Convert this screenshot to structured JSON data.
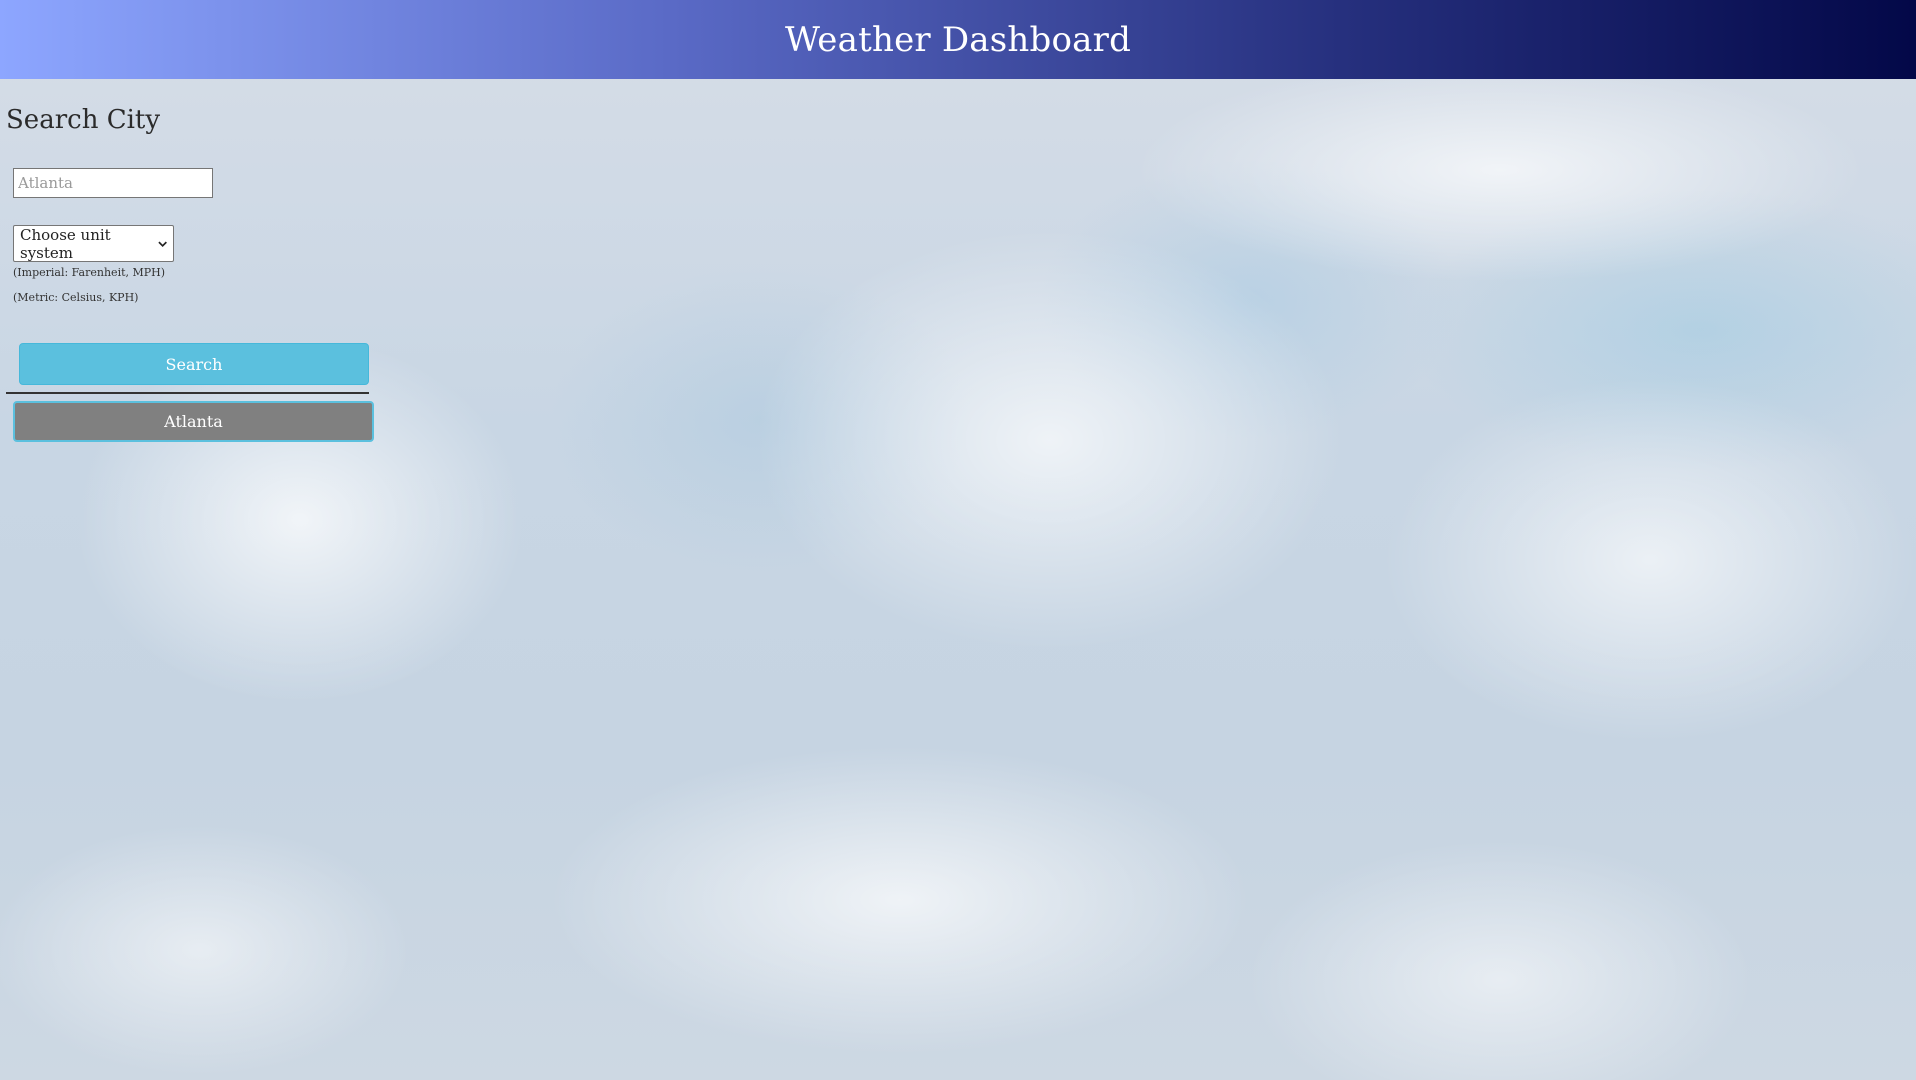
{
  "header": {
    "title": "Weather Dashboard"
  },
  "search": {
    "heading": "Search City",
    "input_placeholder": "Atlanta",
    "unit_select_label": "Choose unit system",
    "imperial_hint": "(Imperial: Farenheit, MPH)",
    "metric_hint": "(Metric: Celsius, KPH)",
    "search_button_label": "Search"
  },
  "history": {
    "items": [
      {
        "label": "Atlanta"
      }
    ]
  },
  "colors": {
    "header_gradient_start": "#8da6ff",
    "header_gradient_end": "#030848",
    "search_button": "#5bc0de",
    "history_button": "#808080"
  },
  "icons": {
    "select_arrow": "chevron-down-icon"
  }
}
